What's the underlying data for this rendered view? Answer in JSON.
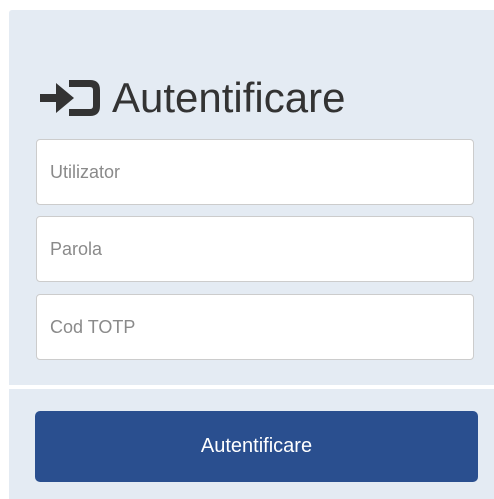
{
  "login": {
    "title": "Autentificare",
    "title_icon": "sign-in-icon",
    "fields": {
      "username": {
        "placeholder": "Utilizator",
        "value": ""
      },
      "password": {
        "placeholder": "Parola",
        "value": ""
      },
      "totp": {
        "placeholder": "Cod TOTP",
        "value": ""
      }
    },
    "submit_label": "Autentificare"
  },
  "colors": {
    "panel_background": "#e4ebf3",
    "button_background": "#2a4f8f",
    "button_text": "#ffffff",
    "title_text": "#333333"
  }
}
